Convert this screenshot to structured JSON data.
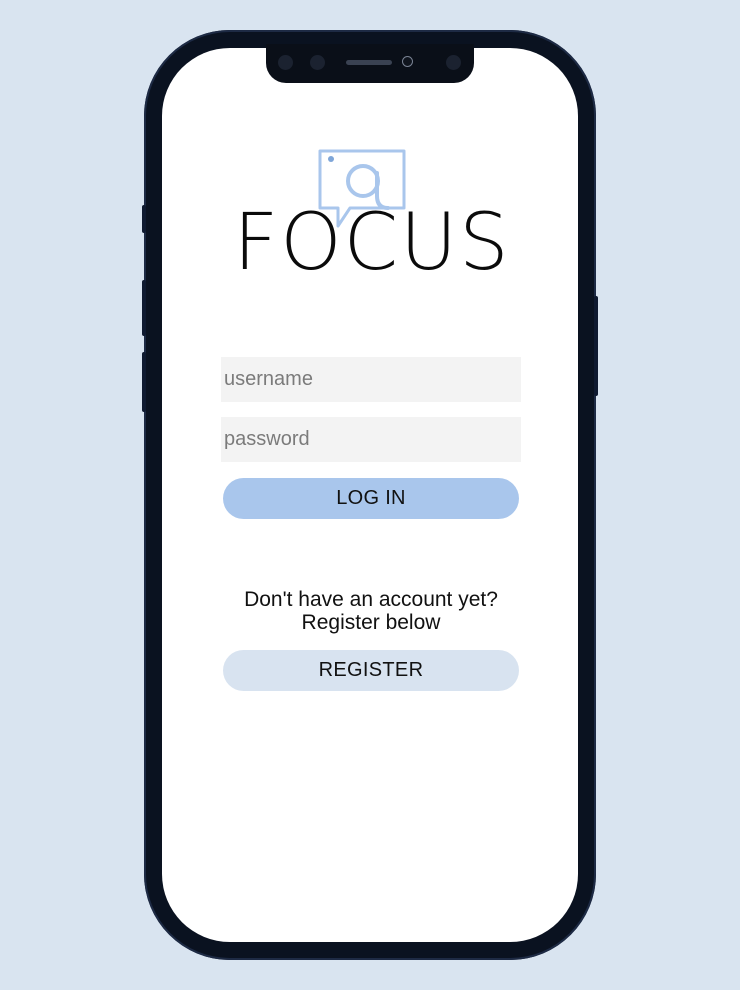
{
  "app": {
    "brand_name": "FOCUS",
    "logo_icon": "chat-bubble-search-icon",
    "accent_color": "#a9c6ec"
  },
  "login_form": {
    "username_placeholder": "username",
    "password_placeholder": "password",
    "login_label": "LOG IN"
  },
  "register": {
    "prompt_line1": "Don't have an account yet?",
    "prompt_line2": "Register below",
    "register_label": "REGISTER"
  }
}
